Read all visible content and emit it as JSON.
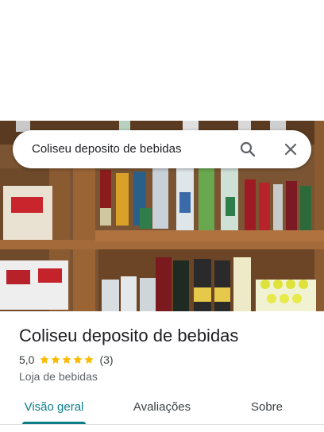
{
  "search": {
    "query": "Coliseu deposito de bebidas",
    "search_icon": "search-icon",
    "close_icon": "close-icon"
  },
  "photo": {
    "subject": "store-shelves-photo"
  },
  "place": {
    "name": "Coliseu deposito de bebidas",
    "rating": "5,0",
    "stars_filled": 5,
    "stars_total": 5,
    "review_count": "(3)",
    "category": "Loja de bebidas"
  },
  "tabs": [
    {
      "label": "Visão geral",
      "active": true
    },
    {
      "label": "Avaliações",
      "active": false
    },
    {
      "label": "Sobre",
      "active": false
    }
  ],
  "colors": {
    "accent": "#0b7d86",
    "star": "#fbbc04"
  }
}
